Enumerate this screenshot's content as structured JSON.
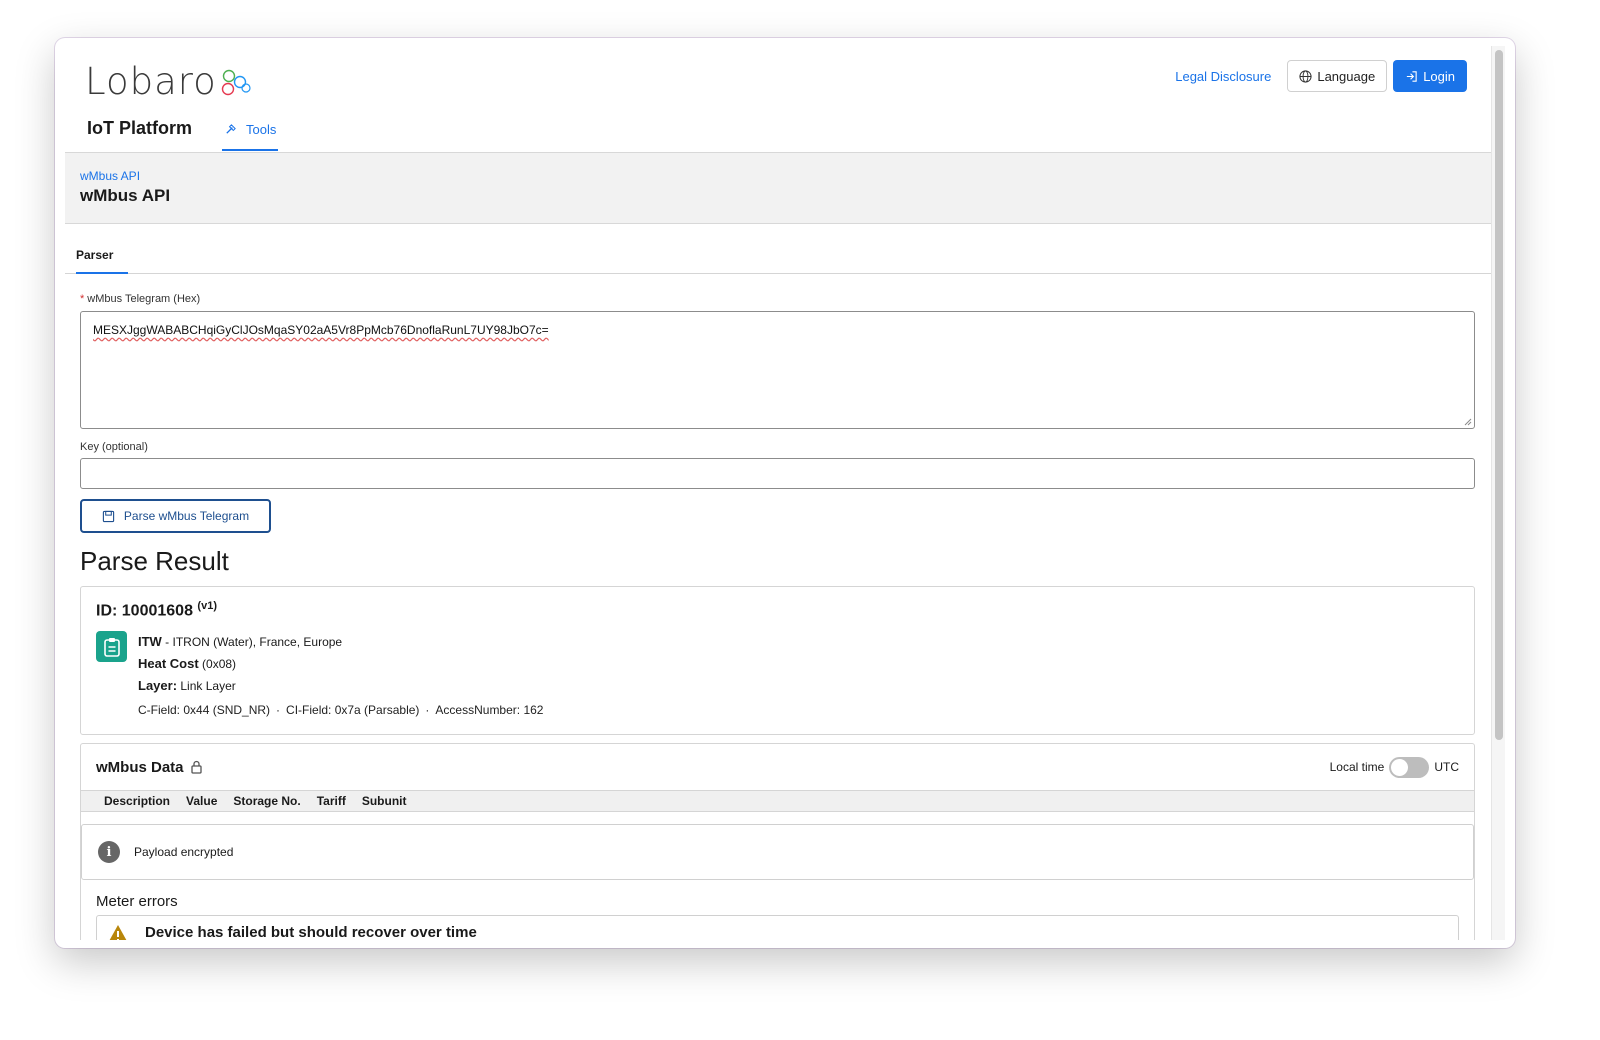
{
  "logo": {
    "text": "Lobaro"
  },
  "header": {
    "legal_link": "Legal Disclosure",
    "language_label": "Language",
    "login_label": "Login"
  },
  "nav": {
    "title": "IoT Platform",
    "tools_tab": "Tools"
  },
  "page": {
    "breadcrumb": "wMbus API",
    "title": "wMbus API"
  },
  "tabs": {
    "parser": "Parser"
  },
  "form": {
    "telegram_label": "wMbus Telegram (Hex)",
    "telegram_value": "MESXJggWABABCHqiGyClJOsMqaSY02aA5Vr8PpMcb76DnoflaRunL7UY98JbO7c=",
    "key_label": "Key (optional)",
    "key_value": "",
    "parse_button": "Parse wMbus Telegram"
  },
  "result": {
    "heading": "Parse Result",
    "id_label": "ID: 10001608",
    "version": "(v1)",
    "manufacturer_code": "ITW",
    "manufacturer_desc": "- ITRON (Water), France, Europe",
    "device_type": "Heat Cost",
    "device_type_code": "(0x08)",
    "layer_label": "Layer:",
    "layer_value": "Link Layer",
    "c_field": "C-Field: 0x44 (SND_NR)",
    "ci_field": "CI-Field: 0x7a (Parsable)",
    "access_number": "AccessNumber: 162",
    "separator": "·"
  },
  "data": {
    "title": "wMbus Data",
    "local_time": "Local time",
    "utc": "UTC",
    "utc_enabled": false,
    "columns": [
      "Description",
      "Value",
      "Storage No.",
      "Tariff",
      "Subunit"
    ],
    "notice": "Payload encrypted",
    "meter_errors_heading": "Meter errors",
    "error_text": "Device has failed but should recover over time"
  },
  "colors": {
    "accent": "#1a73e8",
    "device_icon": "#1aa38c",
    "warning": "#b8860b"
  }
}
